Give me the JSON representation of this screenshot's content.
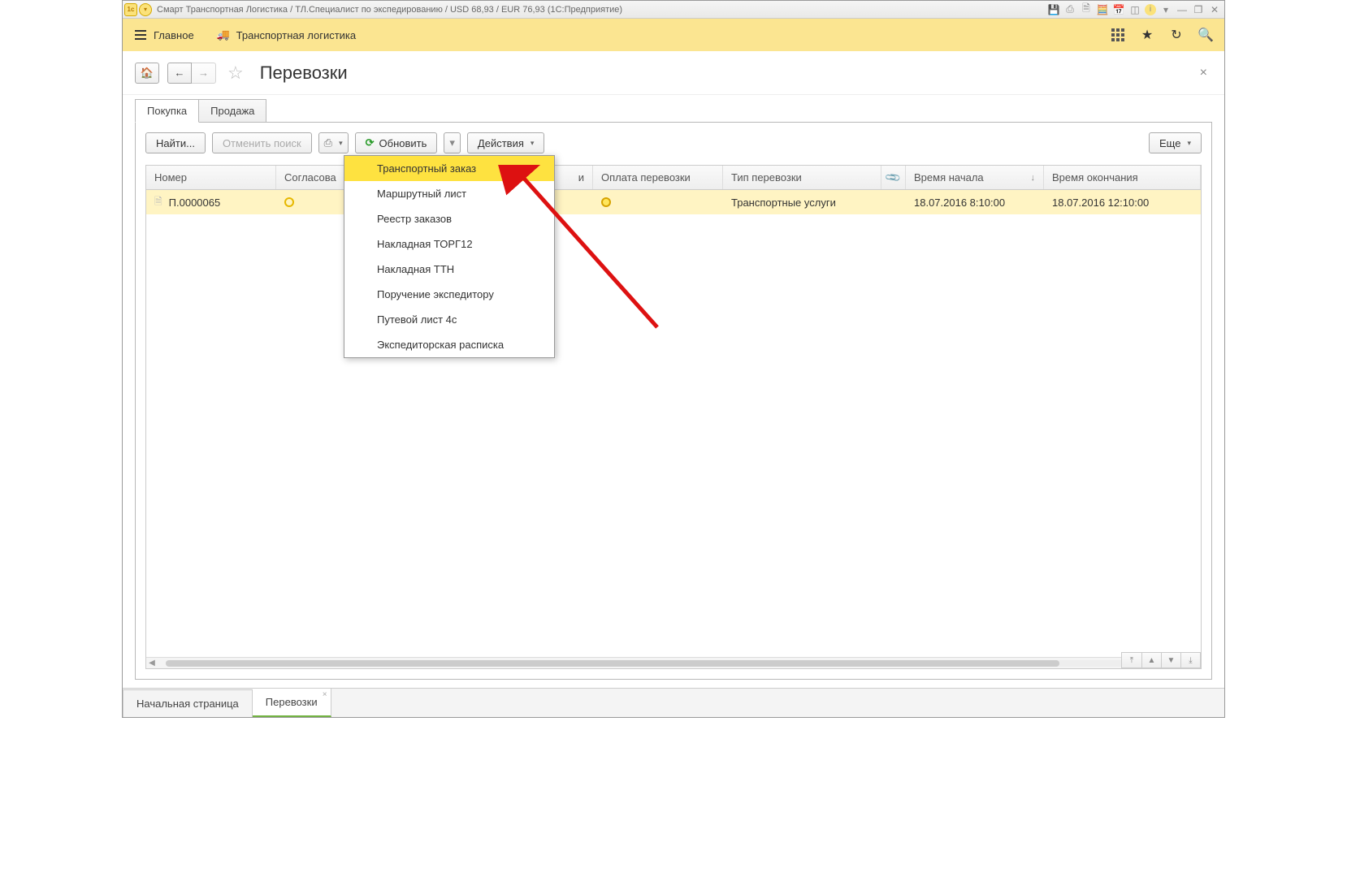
{
  "titlebar": {
    "title": "Смарт Транспортная Логистика / ТЛ.Специалист по экспедированию / USD 68,93 / EUR 76,93  (1С:Предприятие)"
  },
  "navbar": {
    "main": "Главное",
    "logistics": "Транспортная логистика"
  },
  "page": {
    "title": "Перевозки"
  },
  "tabs": {
    "buy": "Покупка",
    "sell": "Продажа"
  },
  "toolbar": {
    "find": "Найти...",
    "cancel_search": "Отменить поиск",
    "refresh": "Обновить",
    "actions": "Действия",
    "more": "Еще"
  },
  "dropdown": {
    "items": [
      "Транспортный заказ",
      "Маршрутный лист",
      "Реестр заказов",
      "Накладная ТОРГ12",
      "Накладная ТТН",
      "Поручение экспедитору",
      "Путевой лист 4с",
      "Экспедиторская расписка"
    ]
  },
  "columns": {
    "number": "Номер",
    "agreed": "Согласова",
    "forwarder": "и",
    "payment": "Оплата перевозки",
    "type": "Тип перевозки",
    "start": "Время начала",
    "end": "Время окончания"
  },
  "row": {
    "number": "П.0000065",
    "type": "Транспортные услуги",
    "start": "18.07.2016 8:10:00",
    "end": "18.07.2016 12:10:00"
  },
  "bottom_tabs": {
    "home": "Начальная страница",
    "transports": "Перевозки"
  }
}
